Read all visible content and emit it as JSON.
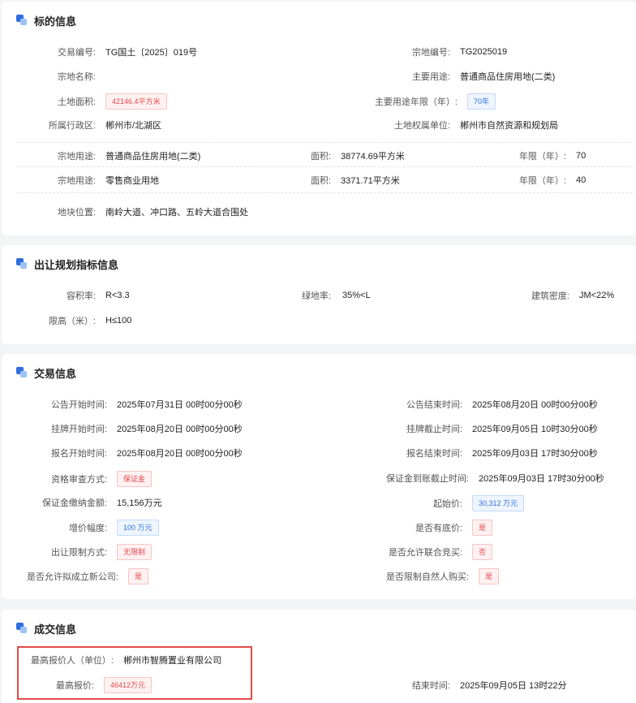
{
  "sections": {
    "subject": {
      "title": "标的信息",
      "trade_no": {
        "label": "交易编号:",
        "value": "TG国土〔2025〕019号"
      },
      "parcel_no": {
        "label": "宗地编号:",
        "value": "TG2025019"
      },
      "parcel_name": {
        "label": "宗地名称:",
        "value": ""
      },
      "main_use": {
        "label": "主要用途:",
        "value": "普通商品住房用地(二类)"
      },
      "land_area": {
        "label": "土地面积:",
        "value": "42146.4平方米"
      },
      "main_use_years": {
        "label": "主要用途年限（年）:",
        "value": "70年"
      },
      "district": {
        "label": "所属行政区:",
        "value": "郴州市/北湖区"
      },
      "owner_unit": {
        "label": "土地权属单位:",
        "value": "郴州市自然资源和规划局"
      },
      "uses": [
        {
          "use_label": "宗地用途:",
          "use_value": "普通商品住房用地(二类)",
          "area_label": "面积:",
          "area_value": "38774.69平方米",
          "years_label": "年限（年）:",
          "years_value": "70"
        },
        {
          "use_label": "宗地用途:",
          "use_value": "零售商业用地",
          "area_label": "面积:",
          "area_value": "3371.71平方米",
          "years_label": "年限（年）:",
          "years_value": "40"
        }
      ],
      "location": {
        "label": "地块位置:",
        "value": "南岭大道、冲口路、五岭大道合围处"
      }
    },
    "planning": {
      "title": "出让规划指标信息",
      "far": {
        "label": "容积率:",
        "value": "R<3.3"
      },
      "green": {
        "label": "绿地率:",
        "value": "35%<L"
      },
      "density": {
        "label": "建筑密度:",
        "value": "JM<22%"
      },
      "height": {
        "label": "限高（米）:",
        "value": "H≤100"
      }
    },
    "trade": {
      "title": "交易信息",
      "notice_start": {
        "label": "公告开始时间:",
        "value": "2025年07月31日 00时00分00秒"
      },
      "notice_end": {
        "label": "公告结束时间:",
        "value": "2025年08月20日 00时00分00秒"
      },
      "listing_start": {
        "label": "挂牌开始时间:",
        "value": "2025年08月20日 00时00分00秒"
      },
      "listing_end": {
        "label": "挂牌截止时间:",
        "value": "2025年09月05日 10时30分00秒"
      },
      "signup_start": {
        "label": "报名开始时间:",
        "value": "2025年08月20日 00时00分00秒"
      },
      "signup_end": {
        "label": "报名结束时间:",
        "value": "2025年09月03日 17时30分00秒"
      },
      "review_method": {
        "label": "资格审查方式:",
        "value": "保证金"
      },
      "deposit_deadline": {
        "label": "保证金到账截止时间:",
        "value": "2025年09月03日 17时30分00秒"
      },
      "deposit_amount": {
        "label": "保证金缴纳金额:",
        "value": "15,156万元"
      },
      "start_price": {
        "label": "起始价:",
        "value": "30,312 万元"
      },
      "increment": {
        "label": "增价幅度:",
        "value": "100 万元"
      },
      "reserve_price": {
        "label": "是否有底价:",
        "value": "是"
      },
      "restriction": {
        "label": "出让限制方式:",
        "value": "无限制"
      },
      "joint_bid": {
        "label": "是否允许联合竞买:",
        "value": "否"
      },
      "new_company": {
        "label": "是否允许拟成立新公司:",
        "value": "是"
      },
      "natural_person": {
        "label": "是否限制自然人购买:",
        "value": "是"
      }
    },
    "deal": {
      "title": "成交信息",
      "top_bidder": {
        "label": "最高报价人（单位）:",
        "value": "郴州市智腾置业有限公司"
      },
      "top_price": {
        "label": "最高报价:",
        "value": "46412万元"
      },
      "end_time": {
        "label": "结束时间:",
        "value": "2025年09月05日 13时22分"
      }
    }
  },
  "colors": {
    "accent": "#2f6fde",
    "highlight_border": "#e24a4a",
    "tag_red": "#e5484d",
    "tag_blue": "#2f6fde"
  }
}
